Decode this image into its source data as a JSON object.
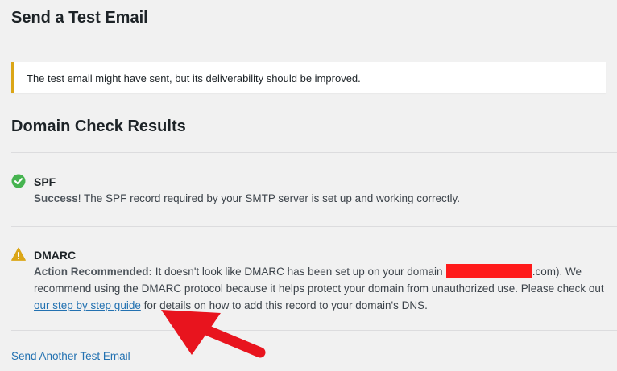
{
  "page": {
    "send_test_title": "Send a Test Email",
    "notice_text": "The test email might have sent, but its deliverability should be improved.",
    "domain_check_title": "Domain Check Results",
    "send_another_link": "Send Another Test Email"
  },
  "checks": [
    {
      "name": "SPF",
      "icon": "check-circle-icon",
      "status_label": "Success",
      "body": "! The SPF record required by your SMTP server is set up and working correctly."
    },
    {
      "name": "DMARC",
      "icon": "warning-icon",
      "status_label": "Action Recommended:",
      "body_before_domain": " It doesn't look like DMARC has been set up on your domain (",
      "domain_suffix": ".com). We recommend using the DMARC protocol because it helps protect your domain from unauthorized use. Please check out ",
      "guide_link": "our step by step guide",
      "body_after_link": " for details on how to add this record to your domain's DNS."
    }
  ],
  "colors": {
    "notice_accent": "#dba617",
    "success": "#46b450",
    "warning": "#dba617",
    "link": "#2271b1",
    "redaction": "#ff1a1a",
    "annotation_arrow": "#e8141e"
  }
}
